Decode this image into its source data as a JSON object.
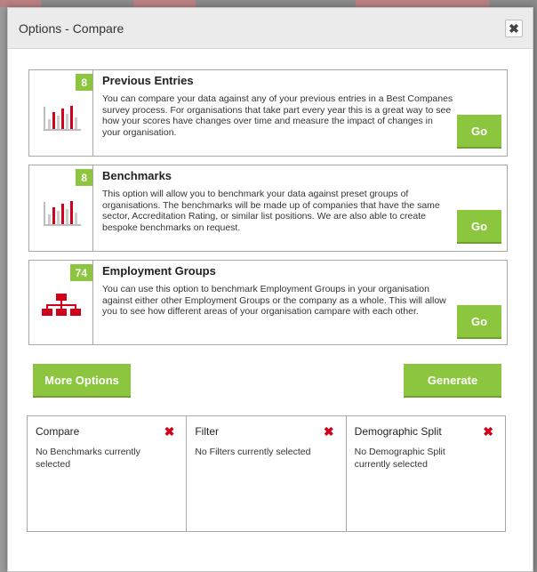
{
  "dialog": {
    "title": "Options - Compare",
    "close_label": "✖"
  },
  "cards": [
    {
      "badge": "8",
      "title": "Previous Entries",
      "description": "You can compare your data against any of your previous entries in a Best Companes survey process. For organisations that take part every year this is a great way to see how your scores have changes over time and measure the impact of changes in your organisation.",
      "go_label": "Go",
      "icon": "bar-chart-icon"
    },
    {
      "badge": "8",
      "title": "Benchmarks",
      "description": "This option will allow you to benchmark your data against preset groups of organisations. The benchmarks will be made up of companies that have the same sector, Accreditation Rating, or similar list positions. We are also able to create bespoke benchmarks on request.",
      "go_label": "Go",
      "icon": "bar-chart-icon"
    },
    {
      "badge": "74",
      "title": "Employment Groups",
      "description": "You can use this option to benchmark Employment Groups in your organisation against either other Employment Groups or the company as a whole. This will allow you to see how different areas of your organisation campare with each other.",
      "go_label": "Go",
      "icon": "org-chart-icon"
    }
  ],
  "actions": {
    "more_options": "More Options",
    "generate": "Generate"
  },
  "summary": [
    {
      "heading": "Compare",
      "text": "No Benchmarks currently selected",
      "remove_icon": "✖"
    },
    {
      "heading": "Filter",
      "text": "No Filters currently selected",
      "remove_icon": "✖"
    },
    {
      "heading": "Demographic Split",
      "text": "No Demographic Split currently selected",
      "remove_icon": "✖"
    }
  ],
  "colors": {
    "accent_green": "#8cc63f",
    "remove_red": "#d0021b",
    "chart_red": "#d0021b"
  }
}
